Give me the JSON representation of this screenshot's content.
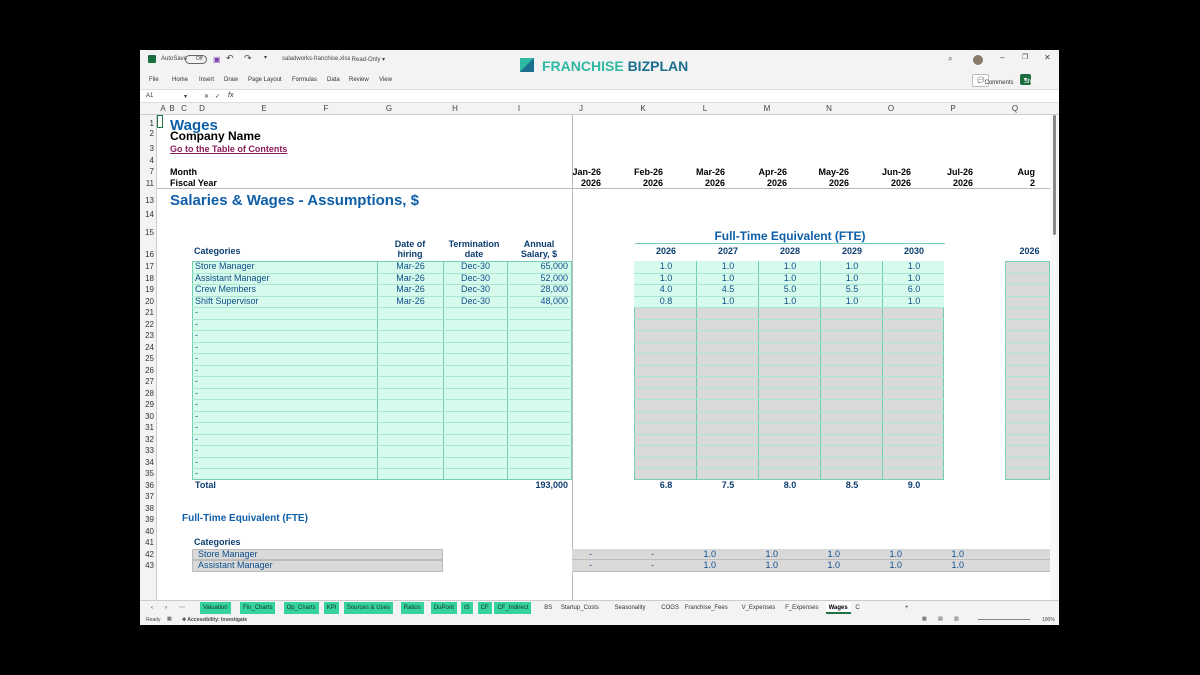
{
  "titlebar": {
    "autosave": "AutoSave",
    "autosave_state": "Off",
    "filename": "saladworks-franchise.xlsx",
    "mode": "Read-Only",
    "logo_part1": "FRANCHISE ",
    "logo_part2": "BIZPLAN",
    "comments": "Comments",
    "share": "Share"
  },
  "menu": [
    "File",
    "Home",
    "Insert",
    "Draw",
    "Page Layout",
    "Formulas",
    "Data",
    "Review",
    "View"
  ],
  "formula": {
    "cell_ref": "A1",
    "fx": "fx"
  },
  "columns": [
    "A",
    "B",
    "C",
    "D",
    "E",
    "F",
    "G",
    "H",
    "I",
    "J",
    "K",
    "L",
    "M",
    "N",
    "O",
    "P",
    "Q"
  ],
  "rows": [
    "1",
    "2",
    "3",
    "4",
    "7",
    "11",
    "13",
    "14",
    "15",
    "16",
    "17",
    "18",
    "19",
    "20",
    "21",
    "22",
    "23",
    "24",
    "25",
    "26",
    "27",
    "28",
    "29",
    "30",
    "31",
    "32",
    "33",
    "34",
    "35",
    "36",
    "37",
    "38",
    "39",
    "40",
    "41",
    "42",
    "43"
  ],
  "sheet": {
    "title": "Wages",
    "company": "Company Name",
    "toc_link": "Go to the Table of Contents",
    "month_label": "Month",
    "fiscal_label": "Fiscal Year",
    "months": [
      "Jan-26",
      "Feb-26",
      "Mar-26",
      "Apr-26",
      "May-26",
      "Jun-26",
      "Jul-26",
      "Aug"
    ],
    "fiscal_years": [
      "2026",
      "2026",
      "2026",
      "2026",
      "2026",
      "2026",
      "2026",
      "2"
    ],
    "section_title": "Salaries & Wages - Assumptions, $",
    "fte_title": "Full-Time Equivalent (FTE)",
    "col_categories": "Categories",
    "col_hire": "Date of hiring",
    "col_term": "Termination date",
    "col_salary": "Annual Salary, $",
    "fte_years": [
      "2026",
      "2027",
      "2028",
      "2029",
      "2030"
    ],
    "fte_year_far": "2026",
    "employees": [
      {
        "name": "Store Manager",
        "hire": "Mar-26",
        "term": "Dec-30",
        "salary": "65,000",
        "fte": [
          "1.0",
          "1.0",
          "1.0",
          "1.0",
          "1.0"
        ]
      },
      {
        "name": "Assistant Manager",
        "hire": "Mar-26",
        "term": "Dec-30",
        "salary": "52,000",
        "fte": [
          "1.0",
          "1.0",
          "1.0",
          "1.0",
          "1.0"
        ]
      },
      {
        "name": "Crew Members",
        "hire": "Mar-26",
        "term": "Dec-30",
        "salary": "28,000",
        "fte": [
          "4.0",
          "4.5",
          "5.0",
          "5.5",
          "6.0"
        ]
      },
      {
        "name": "Shift Supervisor",
        "hire": "Mar-26",
        "term": "Dec-30",
        "salary": "48,000",
        "fte": [
          "0.8",
          "1.0",
          "1.0",
          "1.0",
          "1.0"
        ]
      }
    ],
    "empty_marker": "-",
    "total_label": "Total",
    "total_salary": "193,000",
    "fte_totals": [
      "6.8",
      "7.5",
      "8.0",
      "8.5",
      "9.0"
    ],
    "fte2_title": "Full-Time Equivalent (FTE)",
    "categories2": "Categories",
    "lower_rows": [
      {
        "name": "Store Manager",
        "vals": [
          "-",
          "-",
          "1.0",
          "1.0",
          "1.0",
          "1.0",
          "1.0"
        ]
      },
      {
        "name": "Assistant Manager",
        "vals": [
          "-",
          "-",
          "1.0",
          "1.0",
          "1.0",
          "1.0",
          "1.0"
        ]
      }
    ]
  },
  "tabs": [
    {
      "name": "Valuation",
      "style": "g"
    },
    {
      "name": "Fin_Charts",
      "style": "g"
    },
    {
      "name": "Op_Charts",
      "style": "g"
    },
    {
      "name": "KPI",
      "style": "g"
    },
    {
      "name": "Sources & Uses",
      "style": "g"
    },
    {
      "name": "Ratios",
      "style": "g"
    },
    {
      "name": "DuPont",
      "style": "g"
    },
    {
      "name": "IS",
      "style": "g"
    },
    {
      "name": "CF",
      "style": "g"
    },
    {
      "name": "CF_Indirect",
      "style": "g"
    },
    {
      "name": "BS",
      "style": ""
    },
    {
      "name": "Startup_Costs",
      "style": ""
    },
    {
      "name": "Seasonality",
      "style": ""
    },
    {
      "name": "COGS",
      "style": ""
    },
    {
      "name": "Franchise_Fees",
      "style": ""
    },
    {
      "name": "V_Expenses",
      "style": ""
    },
    {
      "name": "F_Expenses",
      "style": ""
    },
    {
      "name": "Wages",
      "style": "act"
    },
    {
      "name": "C",
      "style": ""
    }
  ],
  "status": {
    "ready": "Ready",
    "accessibility": "Accessibility: Investigate",
    "zoom": "100%"
  }
}
